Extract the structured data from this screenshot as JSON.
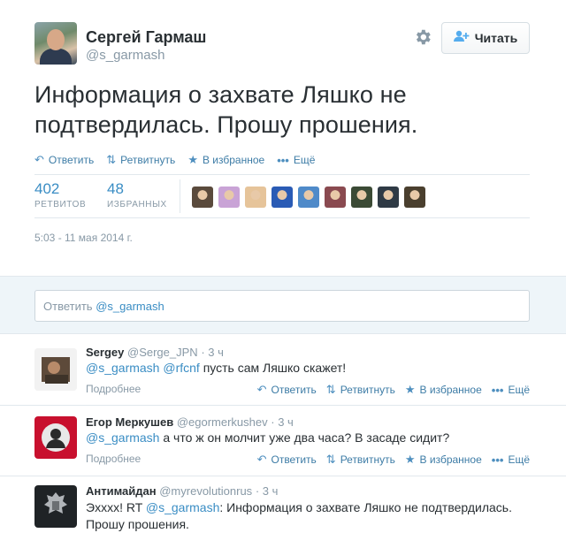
{
  "tweet": {
    "fullname": "Сергей Гармаш",
    "username": "@s_garmash",
    "follow_label": "Читать",
    "text": "Информация о захвате Ляшко не подтвердилась. Прошу прошения.",
    "actions": {
      "reply": "Ответить",
      "retweet": "Ретвитнуть",
      "favorite": "В избранное",
      "more": "Ещё"
    },
    "stats": {
      "retweets_count": "402",
      "retweets_label": "РЕТВИТОВ",
      "favorites_count": "48",
      "favorites_label": "ИЗБРАННЫХ"
    },
    "timestamp": "5:03 - 11 мая 2014 г."
  },
  "favoriters_colors": [
    "#5a4a3c",
    "#c9a3d6",
    "#e6c49a",
    "#2a5bb5",
    "#4f8ac9",
    "#8a4a50",
    "#3b4a35",
    "#2f3a45",
    "#4a3f2e"
  ],
  "reply_box": {
    "prefix": "Ответить",
    "mention": "@s_garmash"
  },
  "replies": [
    {
      "name": "Sergey",
      "username": "@Serge_JPN",
      "time": "· 3 ч",
      "mentions": [
        "@s_garmash",
        "@rfcnf"
      ],
      "text": "пусть сам Ляшко скажет!",
      "more": "Подробнее",
      "reply": "Ответить",
      "retweet": "Ретвитнуть",
      "favorite": "В избранное",
      "extra": "Ещё"
    },
    {
      "name": "Егор Меркушев",
      "username": "@egormerkushev",
      "time": "· 3 ч",
      "mention": "@s_garmash",
      "text": "а что ж он молчит уже два часа? В засаде сидит?",
      "more": "Подробнее",
      "reply": "Ответить",
      "retweet": "Ретвитнуть",
      "favorite": "В избранное",
      "extra": "Ещё"
    },
    {
      "name": "Антимайдан",
      "username": "@myrevolutionrus",
      "time": "· 3 ч",
      "prefix": "Эхххх! RT",
      "mention": "@s_garmash",
      "text_line1": ": Информация о захвате Ляшко не подтвердилась.",
      "text_line2": "Прошу прошения."
    }
  ]
}
